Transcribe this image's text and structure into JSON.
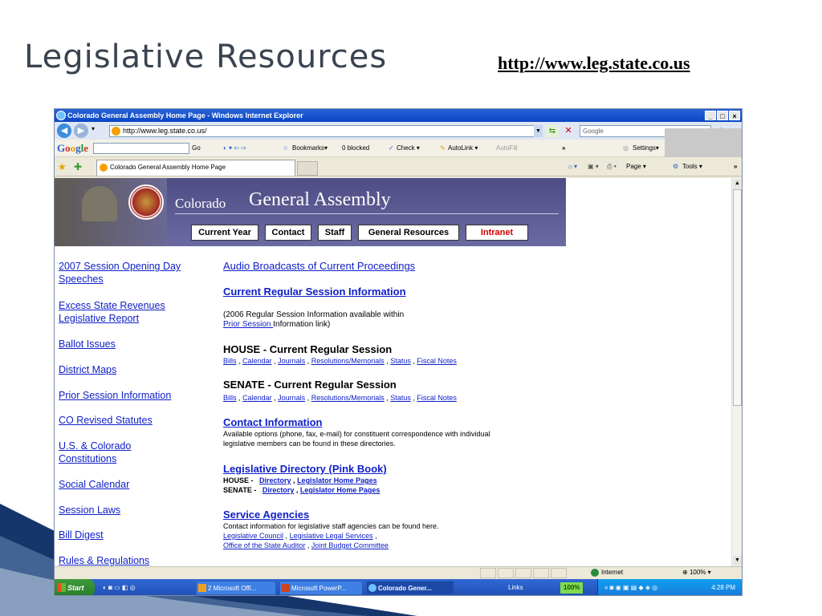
{
  "slide": {
    "title": "Legislative Resources",
    "url": "http://www.leg.state.co.us"
  },
  "browser": {
    "window_title": "Colorado General Assembly Home Page - Windows Internet Explorer",
    "window_buttons": [
      "_",
      "□",
      "×"
    ],
    "address": "http://www.leg.state.co.us/",
    "search_placeholder": "Google",
    "google_toolbar": {
      "go": "Go",
      "bookmarks": "Bookmarks▾",
      "blocked": "0 blocked",
      "check": "Check ▾",
      "autolink": "AutoLink ▾",
      "autofill": "AutoFill",
      "more": "»",
      "settings": "Settings▾"
    },
    "tab_title": "Colorado General Assembly Home Page",
    "command_bar": {
      "page": "Page ▾",
      "tools": "Tools ▾",
      "more": "»"
    }
  },
  "site": {
    "brand_small": "Colorado",
    "brand_big": "General Assembly",
    "nav": [
      "Current Year",
      "Contact",
      "Staff",
      "General Resources",
      "Intranet"
    ],
    "left_links": [
      [
        "2007 Session Opening Day",
        "Speeches"
      ],
      [
        "Excess State Revenues",
        "Legislative Report"
      ],
      [
        "Ballot Issues"
      ],
      [
        "District Maps"
      ],
      [
        "Prior Session Information"
      ],
      [
        "CO Revised Statutes"
      ],
      [
        "U.S. & Colorado",
        "Constitutions"
      ],
      [
        "Social Calendar"
      ],
      [
        "Session Laws"
      ],
      [
        "Bill Digest"
      ],
      [
        "Rules & Regulations"
      ]
    ],
    "audio": "Audio Broadcasts of Current Proceedings",
    "current_session": "Current Regular Session Information",
    "session_note_1": "(2006 Regular Session Information available within",
    "session_note_link": "Prior Session ",
    "session_note_2": "Information link)",
    "house_heading": "HOUSE - Current Regular Session",
    "senate_heading": "SENATE - Current Regular Session",
    "session_links": [
      "Bills",
      "Calendar",
      "Journals",
      "Resolutions/Memorials",
      "Status",
      "Fiscal Notes"
    ],
    "contact_heading": "Contact Information",
    "contact_text_1": "Available options (phone, fax, e-mail) for constituent correspondence with individual",
    "contact_text_2": "legislative members can be found in these directories.",
    "directory_heading": "Legislative Directory (Pink Book)",
    "house_label": "HOUSE -",
    "senate_label": "SENATE -",
    "directory_link": "Directory",
    "home_pages_link": "Legislator Home Pages",
    "service_heading": "Service Agencies",
    "service_text": "Contact information for legislative staff agencies can be found here.",
    "service_links_1": [
      "Legislative Council",
      "Legislative Legal Services"
    ],
    "service_links_2": [
      "Office of the State Auditor",
      "Joint Budget Committee"
    ]
  },
  "status": {
    "zone": "Internet",
    "zoom": "100%"
  },
  "taskbar": {
    "start": "Start",
    "buttons": [
      "2 Microsoft Offi...",
      "Microsoft PowerP...",
      "Colorado Gener..."
    ],
    "links": "Links",
    "pct": "100%",
    "clock": "4:28 PM"
  },
  "colors": {
    "link": "#1020c8",
    "banner": "#5a5890",
    "intranet": "#d10000",
    "taskbar": "#245edb"
  }
}
